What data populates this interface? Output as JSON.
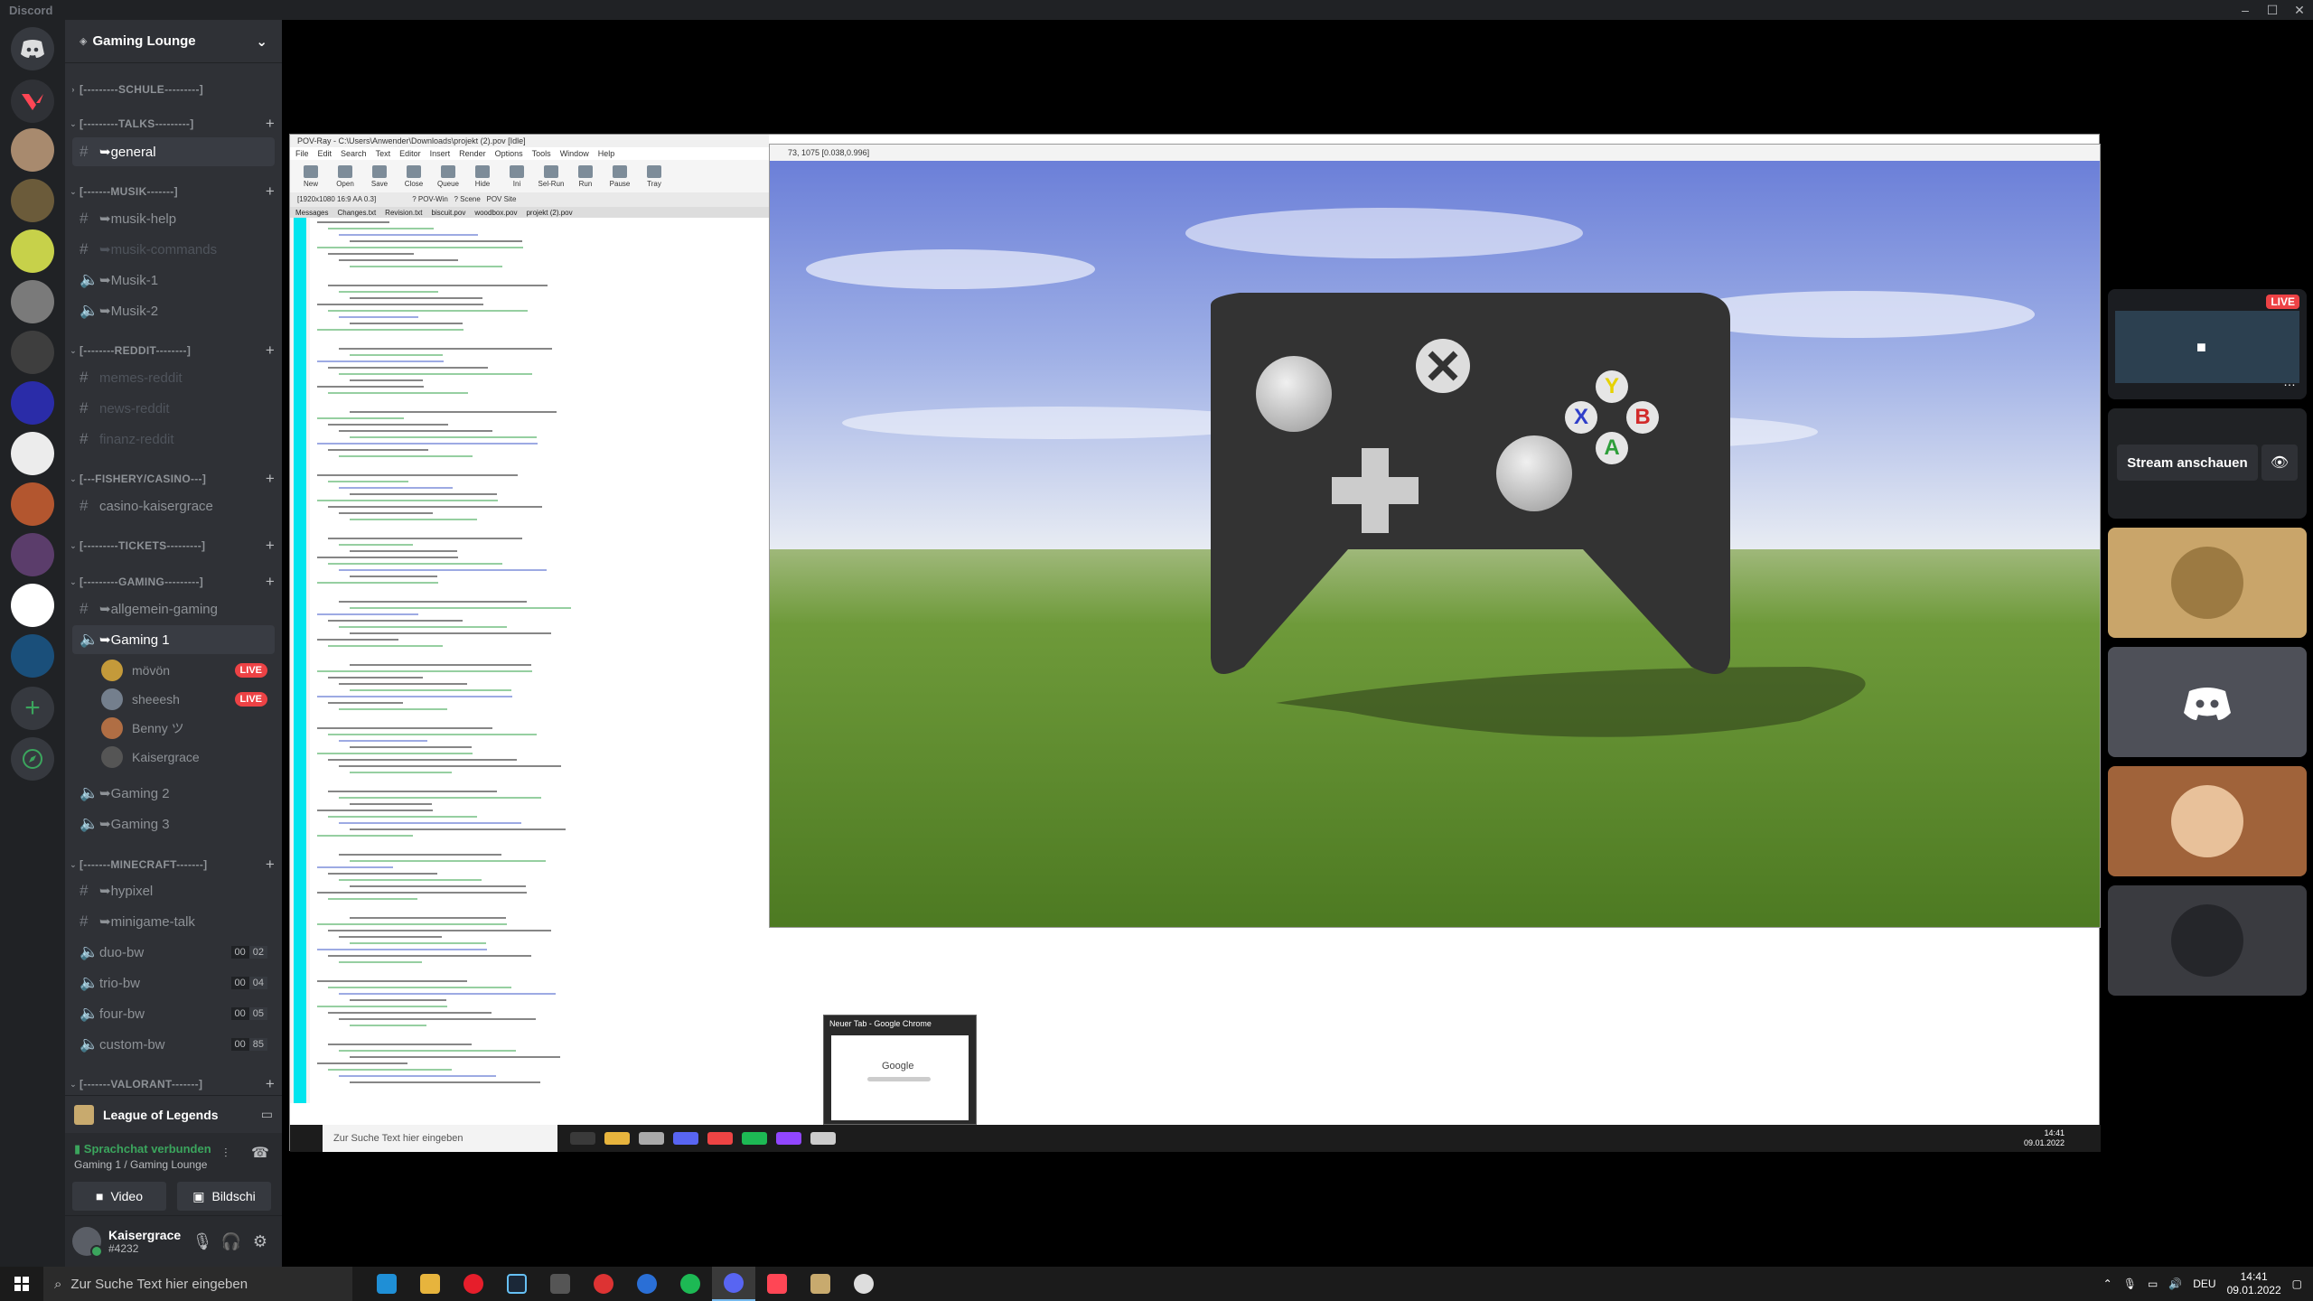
{
  "window": {
    "app_title": "Discord",
    "controls": [
      "–",
      "☐",
      "✕"
    ]
  },
  "guild": {
    "name": "Gaming Lounge",
    "boost_icon": "boost-icon"
  },
  "categories": [
    {
      "label": "[---------SCHULE---------]",
      "collapsed": true
    },
    {
      "label": "[---------TALKS---------]",
      "collapsed": false
    },
    {
      "label": "[-------MUSIK-------]",
      "collapsed": false
    },
    {
      "label": "[--------REDDIT--------]",
      "collapsed": false
    },
    {
      "label": "[---FISHERY/CASINO---]",
      "collapsed": false
    },
    {
      "label": "[---------TICKETS---------]",
      "collapsed": false
    },
    {
      "label": "[---------GAMING---------]",
      "collapsed": false
    },
    {
      "label": "[-------MINECRAFT-------]",
      "collapsed": false
    },
    {
      "label": "[-------VALORANT-------]",
      "collapsed": false
    }
  ],
  "channels": {
    "general": "➥general",
    "musik_help": "➥musik-help",
    "musik_commands": "➥musik-commands",
    "musik1": "➥Musik-1",
    "musik2": "➥Musik-2",
    "memes": "memes-reddit",
    "news": "news-reddit",
    "finanz": "finanz-reddit",
    "casino": "casino-kaisergrace",
    "allgemein_gaming": "➥allgemein-gaming",
    "gaming1": "➥Gaming 1",
    "gaming2": "➥Gaming 2",
    "gaming3": "➥Gaming 3",
    "hypixel": "➥hypixel",
    "minigame": "➥minigame-talk",
    "duo": "duo-bw",
    "trio": "trio-bw",
    "four": "four-bw",
    "custom": "custom-bw",
    "duo_count": [
      "00",
      "02"
    ],
    "trio_count": [
      "00",
      "04"
    ],
    "four_count": [
      "00",
      "05"
    ],
    "custom_count": [
      "00",
      "85"
    ]
  },
  "voice_users": [
    {
      "name": "mövön",
      "live": "LIVE"
    },
    {
      "name": "sheeesh",
      "live": "LIVE"
    },
    {
      "name": "Benny ツ",
      "live": ""
    },
    {
      "name": "Kaisergrace",
      "live": ""
    }
  ],
  "activity": {
    "game": "League of Legends"
  },
  "voice_panel": {
    "status": "Sprachchat verbunden",
    "location": "Gaming 1 / Gaming Lounge",
    "video": "Video",
    "screen": "Bildschi"
  },
  "user": {
    "name": "Kaisergrace",
    "tag": "#4232"
  },
  "stream": {
    "pov_title": "POV-Ray - C:\\Users\\Anwender\\Downloads\\projekt (2).pov [Idle]",
    "pov_menu": [
      "File",
      "Edit",
      "Search",
      "Text",
      "Editor",
      "Insert",
      "Render",
      "Options",
      "Tools",
      "Window",
      "Help"
    ],
    "pov_tools": [
      "New",
      "Open",
      "Save",
      "Close",
      "Queue",
      "Hide",
      "Ini",
      "Sel-Run",
      "Run",
      "Pause",
      "Tray"
    ],
    "pov_resolution": "[1920x1080 16:9 AA 0.3]",
    "pov_links": [
      "? POV-Win",
      "? Scene",
      "POV Site"
    ],
    "pov_tabs": [
      "Messages",
      "Changes.txt",
      "Revision.txt",
      "biscuit.pov",
      "woodbox.pov",
      "projekt (2).pov"
    ],
    "render_title": "73, 1075 [0.038,0.996]",
    "controller_buttons": {
      "y": "Y",
      "x": "X",
      "b": "B",
      "a": "A"
    },
    "taskbar_search": "Zur Suche Text hier eingeben",
    "chrome_preview_title": "Neuer Tab - Google Chrome",
    "chrome_preview_logo": "Google",
    "inner_time": "14:41",
    "inner_date": "09.01.2022"
  },
  "side_tiles": {
    "stream_live": "LIVE",
    "watch_button": "Stream anschauen"
  },
  "taskbar": {
    "search": "Zur Suche Text hier eingeben",
    "lang": "DEU",
    "time": "14:41",
    "date": "09.01.2022"
  },
  "colors": {
    "rail": "#202225",
    "sidebar": "#2f3136",
    "live": "#ed4245",
    "connected": "#3ba55d",
    "blurple": "#5865f2"
  }
}
